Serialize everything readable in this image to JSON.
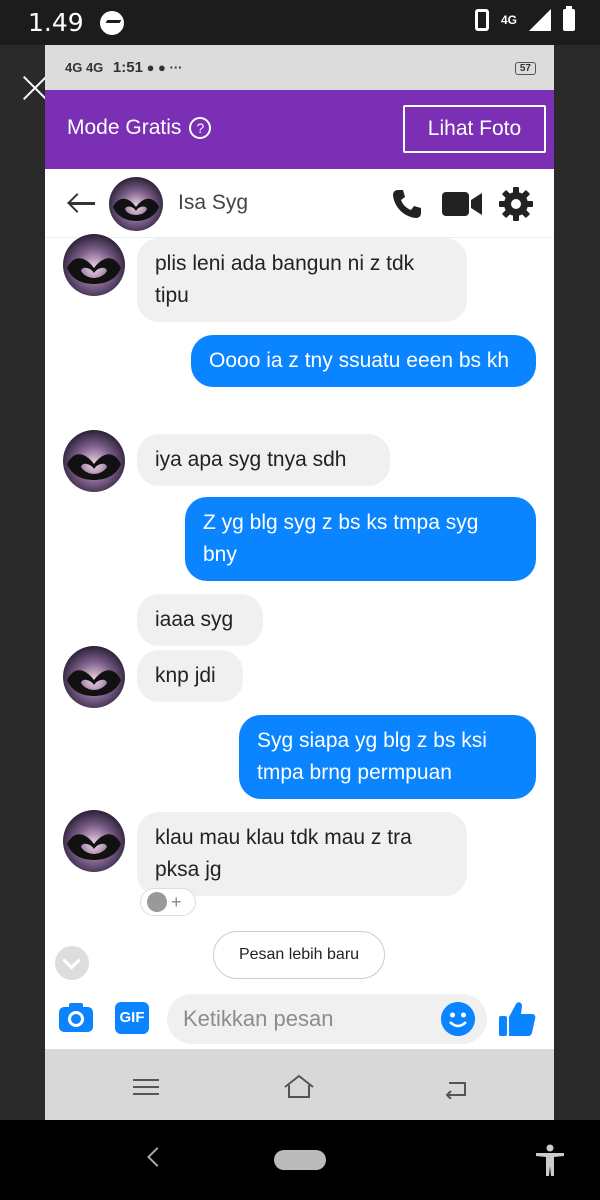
{
  "status_bar": {
    "time": "1.49",
    "network": "4G"
  },
  "inner_status": {
    "network": "4G 4G",
    "time": "1:51",
    "battery": "57"
  },
  "topbar": {
    "mode_label": "Mode Gratis",
    "help_glyph": "?",
    "photo_button": "Lihat Foto"
  },
  "chat": {
    "contact_name": "Isa Syg",
    "icons": [
      "back-arrow-icon",
      "phone-icon",
      "video-icon",
      "gear-icon"
    ]
  },
  "messages": [
    {
      "side": "recv",
      "text": "plis leni ada bangun ni z tdk tipu"
    },
    {
      "side": "sent",
      "text": "Oooo ia z tny ssuatu eeen bs kh"
    },
    {
      "side": "recv",
      "text": "iya apa syg tnya sdh"
    },
    {
      "side": "sent",
      "text": "Z yg blg syg z bs ks tmpa syg bny"
    },
    {
      "side": "recv",
      "text": "iaaa syg"
    },
    {
      "side": "recv",
      "text": "knp jdi"
    },
    {
      "side": "sent",
      "text": "Syg siapa yg blg z bs ksi tmpa brng permpuan"
    },
    {
      "side": "recv",
      "text": "klau mau klau tdk mau z tra pksa jg"
    }
  ],
  "reaction_plus": "+",
  "newer_messages": "Pesan lebih baru",
  "composer": {
    "gif_label": "GIF",
    "placeholder": "Ketikkan pesan"
  },
  "colors": {
    "accent": "#7b2fb5",
    "sent_bubble": "#0b84ff",
    "recv_bubble": "#f1f0f0"
  }
}
